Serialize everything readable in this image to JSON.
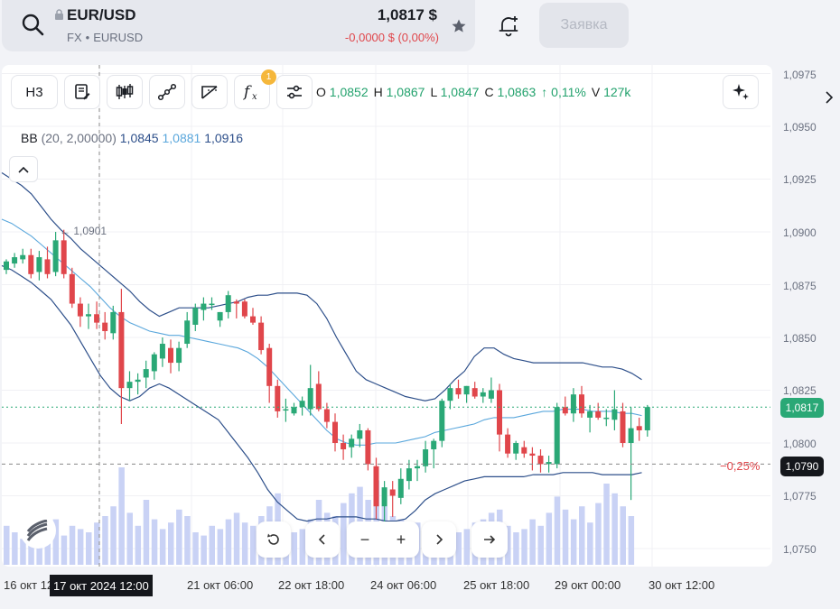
{
  "header": {
    "ticker": "EUR/USD",
    "market": "FX",
    "code": "EURUSD",
    "price": "1,0817 $",
    "change": "-0,0000 $ (0,00%)",
    "order_button": "Заявка"
  },
  "toolbar": {
    "period": "Н3",
    "indicators_badge": "1"
  },
  "ohlc": {
    "o_label": "O",
    "o": "1,0852",
    "h_label": "H",
    "h": "1,0867",
    "l_label": "L",
    "l": "1,0847",
    "c_label": "C",
    "c": "1,0863",
    "chg": "↑ 0,11%",
    "v_label": "V",
    "v": "127k"
  },
  "bb_legend": {
    "name": "BB",
    "params": "(20, 2,00000)",
    "lower": "1,0845",
    "middle": "1,0881",
    "upper": "1,0916"
  },
  "annotations": {
    "high_marker": "1,0901",
    "pct_diff": "−0,25%",
    "current_price_tag": "1,0817",
    "crosshair_price_tag": "1,0790",
    "crosshair_time": "17 окт 2024 12:00"
  },
  "colors": {
    "up": "#2aa876",
    "down": "#e0464b",
    "bb_outer": "#2d4f8a",
    "bb_middle": "#5aa7dc",
    "volume": "#c9d2f5"
  },
  "chart_data": {
    "type": "candlestick",
    "y_ticks": [
      "1,0975",
      "1,0950",
      "1,0925",
      "1,0900",
      "1,0875",
      "1,0850",
      "1,0825",
      "1,0800",
      "1,0775",
      "1,0750"
    ],
    "x_ticks": [
      "16 окт 12:00",
      "21 окт 06:00",
      "22 окт 18:00",
      "24 окт 06:00",
      "25 окт 18:00",
      "29 окт 00:00",
      "30 окт 12:00"
    ],
    "ylim": [
      1.0745,
      1.0985
    ],
    "grid": true,
    "current_price": 1.0817,
    "crosshair_price": 1.079,
    "candles": [
      [
        1.0882,
        1.0887,
        1.088,
        1.0886
      ],
      [
        1.0885,
        1.089,
        1.0883,
        1.0888
      ],
      [
        1.0887,
        1.0892,
        1.0885,
        1.0889
      ],
      [
        1.0889,
        1.0892,
        1.0878,
        1.088
      ],
      [
        1.0881,
        1.0891,
        1.0877,
        1.0888
      ],
      [
        1.0887,
        1.0893,
        1.0878,
        1.088
      ],
      [
        1.0881,
        1.09,
        1.0879,
        1.0896
      ],
      [
        1.0896,
        1.0901,
        1.0878,
        1.088
      ],
      [
        1.088,
        1.0883,
        1.0864,
        1.0866
      ],
      [
        1.0866,
        1.0869,
        1.0855,
        1.086
      ],
      [
        1.086,
        1.0866,
        1.0854,
        1.0861
      ],
      [
        1.0861,
        1.0867,
        1.0854,
        1.0857
      ],
      [
        1.0857,
        1.0862,
        1.0849,
        1.0853
      ],
      [
        1.0852,
        1.0865,
        1.0849,
        1.0862
      ],
      [
        1.0862,
        1.0873,
        1.0809,
        1.0826
      ],
      [
        1.0826,
        1.0834,
        1.082,
        1.0829
      ],
      [
        1.0829,
        1.0833,
        1.0823,
        1.083
      ],
      [
        1.0831,
        1.0839,
        1.0826,
        1.0835
      ],
      [
        1.0834,
        1.0843,
        1.083,
        1.0842
      ],
      [
        1.084,
        1.085,
        1.0836,
        1.0847
      ],
      [
        1.0845,
        1.0849,
        1.0833,
        1.0838
      ],
      [
        1.0838,
        1.0848,
        1.0834,
        1.0845
      ],
      [
        1.0847,
        1.0862,
        1.0845,
        1.0858
      ],
      [
        1.0856,
        1.0866,
        1.0853,
        1.0864
      ],
      [
        1.0863,
        1.0869,
        1.0858,
        1.0866
      ],
      [
        1.0866,
        1.0869,
        1.0863,
        1.0866
      ],
      [
        1.0858,
        1.0862,
        1.0855,
        1.0862
      ],
      [
        1.0862,
        1.0872,
        1.0859,
        1.087
      ],
      [
        1.0867,
        1.0868,
        1.0859,
        1.0866
      ],
      [
        1.0867,
        1.0868,
        1.0859,
        1.086
      ],
      [
        1.086,
        1.0864,
        1.0856,
        1.0857
      ],
      [
        1.0857,
        1.086,
        1.0842,
        1.0844
      ],
      [
        1.0845,
        1.0847,
        1.0819,
        1.0827
      ],
      [
        1.0827,
        1.083,
        1.0812,
        1.0815
      ],
      [
        1.0816,
        1.0821,
        1.081,
        1.0816
      ],
      [
        1.0814,
        1.0819,
        1.0813,
        1.0817
      ],
      [
        1.0817,
        1.0822,
        1.0813,
        1.082
      ],
      [
        1.0816,
        1.0837,
        1.0813,
        1.0826
      ],
      [
        1.0828,
        1.0834,
        1.0815,
        1.0816
      ],
      [
        1.0816,
        1.0819,
        1.0807,
        1.081
      ],
      [
        1.081,
        1.0814,
        1.0796,
        1.08
      ],
      [
        1.08,
        1.0804,
        1.0792,
        1.0797
      ],
      [
        1.0798,
        1.0804,
        1.0793,
        1.0802
      ],
      [
        1.0802,
        1.0809,
        1.0798,
        1.0806
      ],
      [
        1.0806,
        1.0807,
        1.0787,
        1.079
      ],
      [
        1.0789,
        1.0793,
        1.0764,
        1.077
      ],
      [
        1.077,
        1.0782,
        1.0761,
        1.0779
      ],
      [
        1.0778,
        1.0782,
        1.0765,
        1.0775
      ],
      [
        1.0774,
        1.0788,
        1.0771,
        1.0783
      ],
      [
        1.0782,
        1.0792,
        1.0778,
        1.0788
      ],
      [
        1.0788,
        1.0792,
        1.0782,
        1.0789
      ],
      [
        1.0789,
        1.0801,
        1.0786,
        1.0797
      ],
      [
        1.0797,
        1.0802,
        1.0788,
        1.0801
      ],
      [
        1.0801,
        1.0821,
        1.0798,
        1.082
      ],
      [
        1.082,
        1.0828,
        1.0816,
        1.0826
      ],
      [
        1.0826,
        1.083,
        1.0821,
        1.0823
      ],
      [
        1.0823,
        1.0827,
        1.0819,
        1.0827
      ],
      [
        1.0826,
        1.0829,
        1.0821,
        1.0822
      ],
      [
        1.0822,
        1.0826,
        1.0819,
        1.0824
      ],
      [
        1.0821,
        1.0831,
        1.0819,
        1.0825
      ],
      [
        1.0825,
        1.0828,
        1.0796,
        1.0804
      ],
      [
        1.0804,
        1.0807,
        1.0793,
        1.0795
      ],
      [
        1.0795,
        1.0801,
        1.0792,
        1.08
      ],
      [
        1.0798,
        1.0801,
        1.0793,
        1.0795
      ],
      [
        1.0795,
        1.0798,
        1.0787,
        1.0794
      ],
      [
        1.0794,
        1.0797,
        1.0786,
        1.079
      ],
      [
        1.079,
        1.0794,
        1.0786,
        1.0791
      ],
      [
        1.079,
        1.0819,
        1.0788,
        1.0817
      ],
      [
        1.0817,
        1.0822,
        1.0813,
        1.0814
      ],
      [
        1.0814,
        1.0826,
        1.081,
        1.0823
      ],
      [
        1.0823,
        1.0827,
        1.0812,
        1.0814
      ],
      [
        1.0812,
        1.0818,
        1.0805,
        1.0815
      ],
      [
        1.0815,
        1.0819,
        1.0811,
        1.0812
      ],
      [
        1.0812,
        1.0816,
        1.0808,
        1.0812
      ],
      [
        1.0811,
        1.0825,
        1.0806,
        1.0816
      ],
      [
        1.0815,
        1.0819,
        1.0798,
        1.08
      ],
      [
        1.08,
        1.0817,
        1.0773,
        1.0807
      ],
      [
        1.0808,
        1.0812,
        1.0801,
        1.0806
      ],
      [
        1.0806,
        1.0818,
        1.0803,
        1.0817
      ]
    ],
    "volumes": [
      12,
      10,
      8,
      9,
      11,
      10,
      14,
      9,
      12,
      11,
      10,
      13,
      15,
      18,
      30,
      16,
      12,
      20,
      14,
      11,
      13,
      17,
      15,
      10,
      9,
      12,
      11,
      14,
      16,
      13,
      12,
      15,
      18,
      22,
      12,
      10,
      11,
      14,
      20,
      16,
      15,
      19,
      22,
      24,
      20,
      26,
      18,
      15,
      14,
      12,
      13,
      11,
      10,
      9,
      12,
      10,
      11,
      13,
      14,
      16,
      17,
      12,
      10,
      11,
      14,
      12,
      16,
      21,
      17,
      14,
      18,
      13,
      19,
      25,
      22,
      18,
      15
    ],
    "bb_upper": [
      1.0928,
      1.0925,
      1.0922,
      1.0918,
      1.0912,
      1.0906,
      1.0901,
      1.0897,
      1.0892,
      1.0888,
      1.0884,
      1.088,
      1.0876,
      1.0872,
      1.0867,
      1.0863,
      1.086,
      1.0862,
      1.0864,
      1.0864,
      1.0864,
      1.0864,
      1.0865,
      1.0866,
      1.0867,
      1.0869,
      1.087,
      1.087,
      1.0871,
      1.0871,
      1.0871,
      1.087,
      1.0866,
      1.0859,
      1.085,
      1.0842,
      1.0834,
      1.083,
      1.0828,
      1.0826,
      1.0824,
      1.0822,
      1.0821,
      1.082,
      1.0821,
      1.0825,
      1.083,
      1.0834,
      1.0841,
      1.0845,
      1.0845,
      1.0842,
      1.084,
      1.0839,
      1.0838,
      1.0838,
      1.0838,
      1.0838,
      1.0838,
      1.0838,
      1.0837,
      1.0836,
      1.0836,
      1.0835,
      1.0833,
      1.083
    ],
    "bb_middle": [
      1.0906,
      1.0904,
      1.0901,
      1.0898,
      1.0894,
      1.089,
      1.0886,
      1.0882,
      1.0878,
      1.0874,
      1.0869,
      1.0864,
      1.086,
      1.0857,
      1.0855,
      1.0853,
      1.0852,
      1.0851,
      1.0851,
      1.085,
      1.0849,
      1.0848,
      1.0847,
      1.0846,
      1.0845,
      1.0843,
      1.084,
      1.0836,
      1.0831,
      1.0826,
      1.0821,
      1.0816,
      1.0811,
      1.0806,
      1.0802,
      1.08,
      1.0799,
      1.0799,
      1.08,
      1.08,
      1.08,
      1.0801,
      1.0802,
      1.0803,
      1.0805,
      1.0806,
      1.0807,
      1.0808,
      1.0809,
      1.0811,
      1.0812,
      1.0812,
      1.0812,
      1.0813,
      1.0814,
      1.0815,
      1.0815,
      1.0816,
      1.0816,
      1.0816,
      1.0815,
      1.0815,
      1.0815,
      1.0814,
      1.0814,
      1.0813
    ],
    "bb_lower": [
      1.0884,
      1.0882,
      1.0879,
      1.0876,
      1.0872,
      1.0868,
      1.0862,
      1.0856,
      1.0848,
      1.084,
      1.0832,
      1.0826,
      1.0822,
      1.082,
      1.0822,
      1.0826,
      1.0828,
      1.0826,
      1.0823,
      1.082,
      1.0817,
      1.0814,
      1.0811,
      1.0805,
      1.0799,
      1.0793,
      1.0786,
      1.0778,
      1.0772,
      1.0768,
      1.0764,
      1.0763,
      1.0764,
      1.0764,
      1.0765,
      1.0765,
      1.0765,
      1.0764,
      1.0764,
      1.0763,
      1.0763,
      1.0764,
      1.0768,
      1.0773,
      1.0776,
      1.0778,
      1.078,
      1.0782,
      1.0783,
      1.0784,
      1.0784,
      1.0784,
      1.0784,
      1.0784,
      1.0785,
      1.0785,
      1.0785,
      1.0786,
      1.0786,
      1.0786,
      1.0786,
      1.0785,
      1.0785,
      1.0785,
      1.0785,
      1.0786
    ]
  }
}
